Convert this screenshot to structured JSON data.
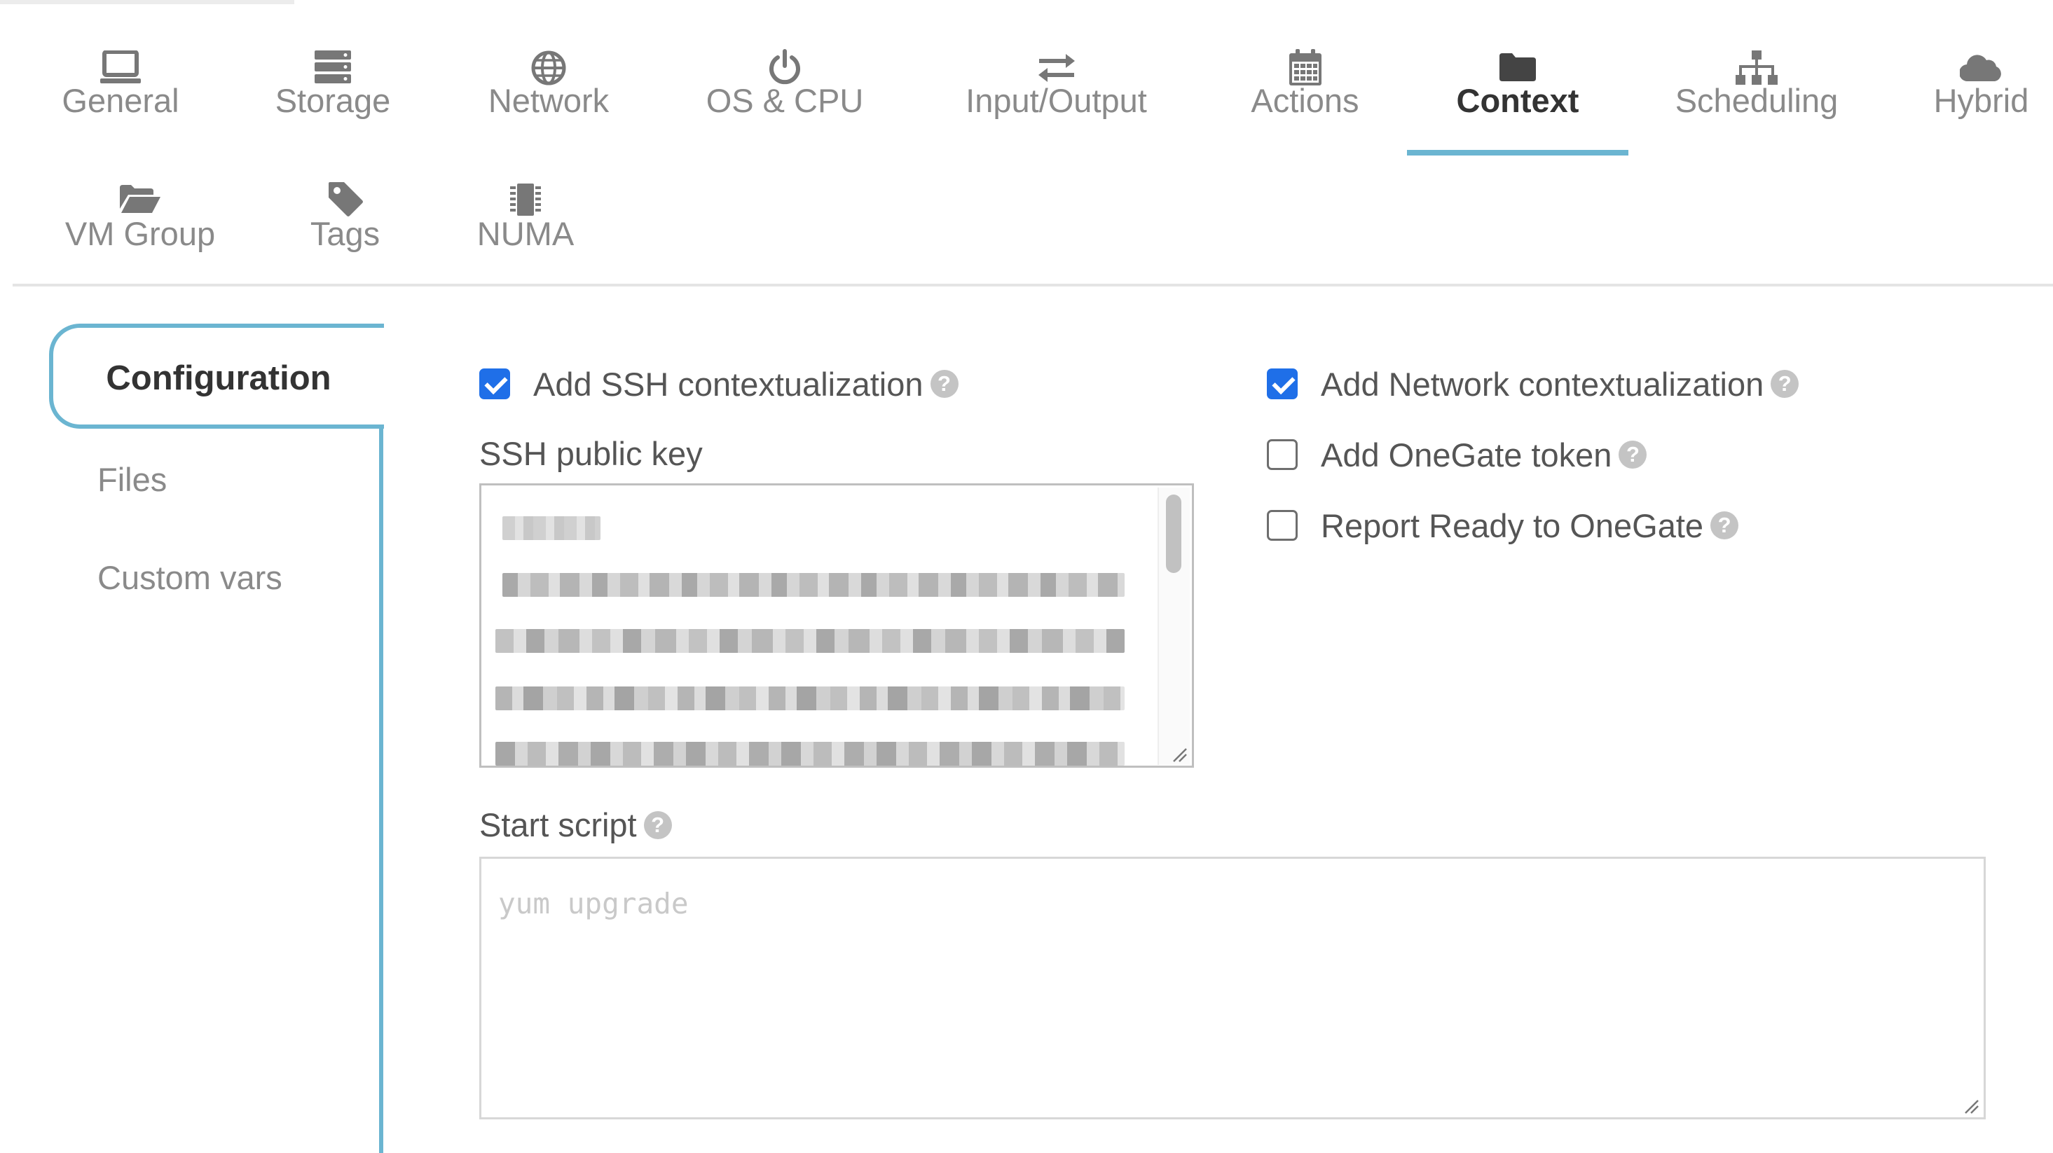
{
  "tabs": [
    {
      "label": "General",
      "icon": "laptop-icon"
    },
    {
      "label": "Storage",
      "icon": "storage-icon"
    },
    {
      "label": "Network",
      "icon": "globe-icon"
    },
    {
      "label": "OS & CPU",
      "icon": "power-icon"
    },
    {
      "label": "Input/Output",
      "icon": "exchange-icon"
    },
    {
      "label": "Actions",
      "icon": "calendar-icon"
    },
    {
      "label": "Context",
      "icon": "folder-icon",
      "active": true
    },
    {
      "label": "Scheduling",
      "icon": "sitemap-icon"
    },
    {
      "label": "Hybrid",
      "icon": "cloud-icon"
    },
    {
      "label": "VM Group",
      "icon": "folder-open-icon"
    },
    {
      "label": "Tags",
      "icon": "tag-icon"
    },
    {
      "label": "NUMA",
      "icon": "chip-icon"
    }
  ],
  "sidebar": {
    "items": [
      {
        "label": "Configuration",
        "active": true
      },
      {
        "label": "Files"
      },
      {
        "label": "Custom vars"
      }
    ]
  },
  "options": {
    "ssh_context": {
      "label": "Add SSH contextualization",
      "checked": true
    },
    "network_context": {
      "label": "Add Network contextualization",
      "checked": true
    },
    "onegate_token": {
      "label": "Add OneGate token",
      "checked": false
    },
    "report_ready": {
      "label": "Report Ready to OneGate",
      "checked": false
    }
  },
  "ssh_public_key": {
    "label": "SSH public key",
    "value_redacted": true
  },
  "start_script": {
    "label": "Start script",
    "placeholder": "yum upgrade"
  },
  "help_symbol": "?",
  "colors": {
    "accent": "#6bb5d1",
    "checkbox_checked": "#1f6fe8",
    "text_active": "#333333",
    "text_muted": "#8a8a8a"
  }
}
